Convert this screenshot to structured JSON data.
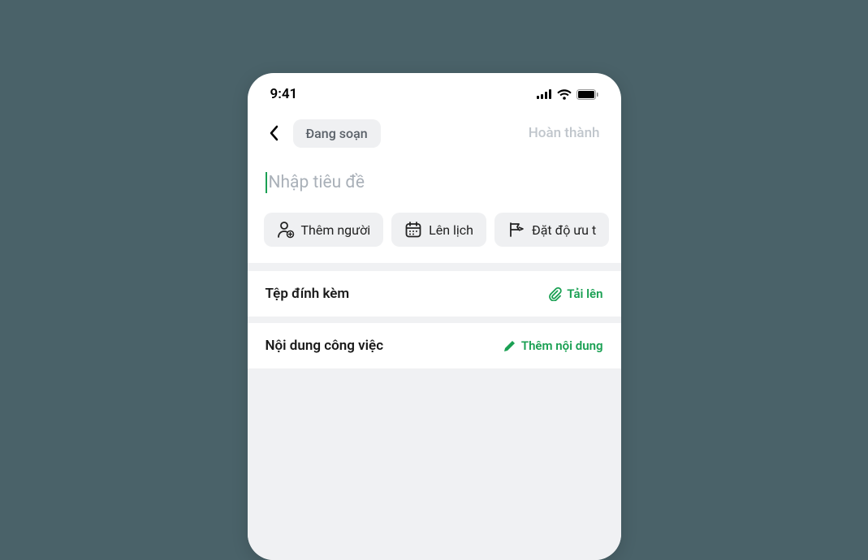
{
  "statusBar": {
    "time": "9:41"
  },
  "nav": {
    "statusChip": "Đang soạn",
    "completeLabel": "Hoàn thành"
  },
  "titleInput": {
    "placeholder": "Nhập tiêu đề"
  },
  "chips": {
    "addPerson": "Thêm người",
    "schedule": "Lên lịch",
    "priority": "Đặt độ ưu t"
  },
  "sections": {
    "attachment": {
      "title": "Tệp đính kèm",
      "action": "Tải lên"
    },
    "content": {
      "title": "Nội dung công việc",
      "action": "Thêm nội dung"
    }
  }
}
